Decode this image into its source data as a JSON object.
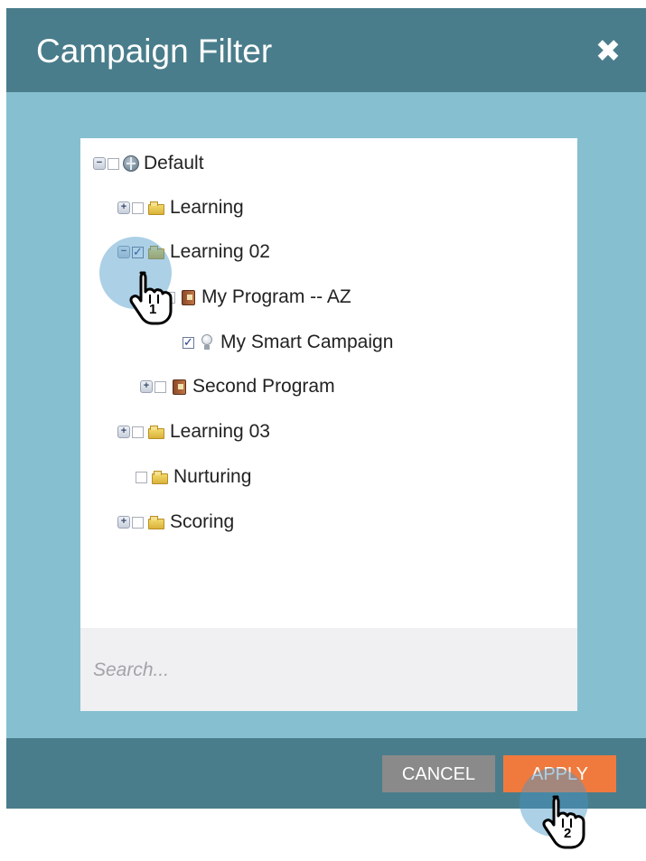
{
  "dialog": {
    "title": "Campaign Filter",
    "close_label": "✖"
  },
  "tree": [
    {
      "toggle": "−",
      "checked": false,
      "icon": "globe-icon",
      "label": "Default"
    },
    {
      "toggle": "+",
      "checked": false,
      "icon": "folder-icon",
      "label": "Learning"
    },
    {
      "toggle": "−",
      "checked": true,
      "icon": "folder-icon",
      "label": "Learning 02"
    },
    {
      "toggle": "",
      "checked": false,
      "icon": "program-icon",
      "label": "My Program -- AZ"
    },
    {
      "toggle": "",
      "checked": true,
      "icon": "lightbulb-icon",
      "label": "My Smart Campaign"
    },
    {
      "toggle": "+",
      "checked": false,
      "icon": "program-icon",
      "label": "Second Program"
    },
    {
      "toggle": "+",
      "checked": false,
      "icon": "folder-icon",
      "label": "Learning 03"
    },
    {
      "toggle": "",
      "checked": false,
      "icon": "folder-icon",
      "label": "Nurturing"
    },
    {
      "toggle": "+",
      "checked": false,
      "icon": "folder-icon",
      "label": "Scoring"
    }
  ],
  "search": {
    "placeholder": "Search...",
    "value": ""
  },
  "footer": {
    "cancel_label": "CANCEL",
    "apply_label": "APPLY"
  },
  "callouts": {
    "step1": "1",
    "step2": "2"
  },
  "colors": {
    "header": "#4a7d8b",
    "body": "#86c0d0",
    "apply": "#f07a3e",
    "cancel": "#8a8a8a"
  }
}
